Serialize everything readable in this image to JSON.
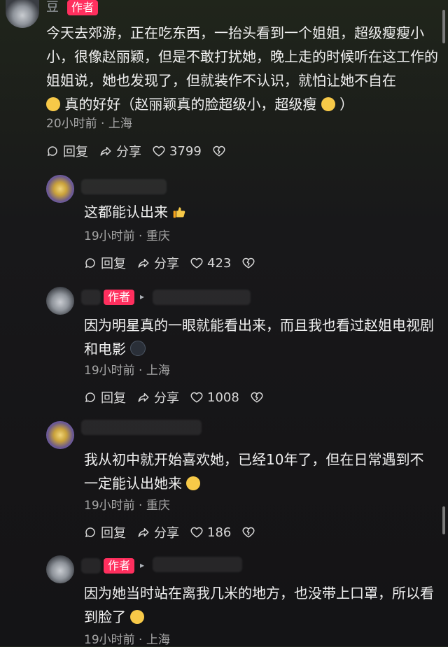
{
  "comments": [
    {
      "id": "c1",
      "name_visible": "豆",
      "tag": "作者",
      "text": "今天去郊游，正在吃东西，一抬头看到一个姐姐，超级瘦瘦小小，很像赵丽颖，但是不敢打扰她，晚上走的时候听在这工作的姐姐说，她也发现了，但就装作不认识，就怕让她不自在",
      "text2": "真的好好（赵丽颖真的脸超级小，超级瘦",
      "text2_end": "）",
      "meta": "20小时前 · 上海",
      "reply": "回复",
      "share": "分享",
      "likes": "3799"
    },
    {
      "id": "c2",
      "text": "这都能认出来",
      "meta": "19小时前 · 重庆",
      "reply": "回复",
      "share": "分享",
      "likes": "423"
    },
    {
      "id": "c3",
      "tag": "作者",
      "text": "因为明星真的一眼就能看出来，而且我也看过赵姐电视剧和电影",
      "meta": "19小时前 · 上海",
      "reply": "回复",
      "share": "分享",
      "likes": "1008"
    },
    {
      "id": "c4",
      "text": "我从初中就开始喜欢她，已经10年了，但在日常遇到不一定能认出她来",
      "meta": "19小时前 · 重庆",
      "reply": "回复",
      "share": "分享",
      "likes": "186"
    },
    {
      "id": "c5",
      "tag": "作者",
      "text": "因为她当时站在离我几米的地方，也没带上口罩，所以看到脸了",
      "meta": "19小时前 · 上海"
    }
  ],
  "colors": {
    "tag_bg": "#ff2f5e",
    "text": "#f0f0f0",
    "meta": "#a7a7a7"
  }
}
